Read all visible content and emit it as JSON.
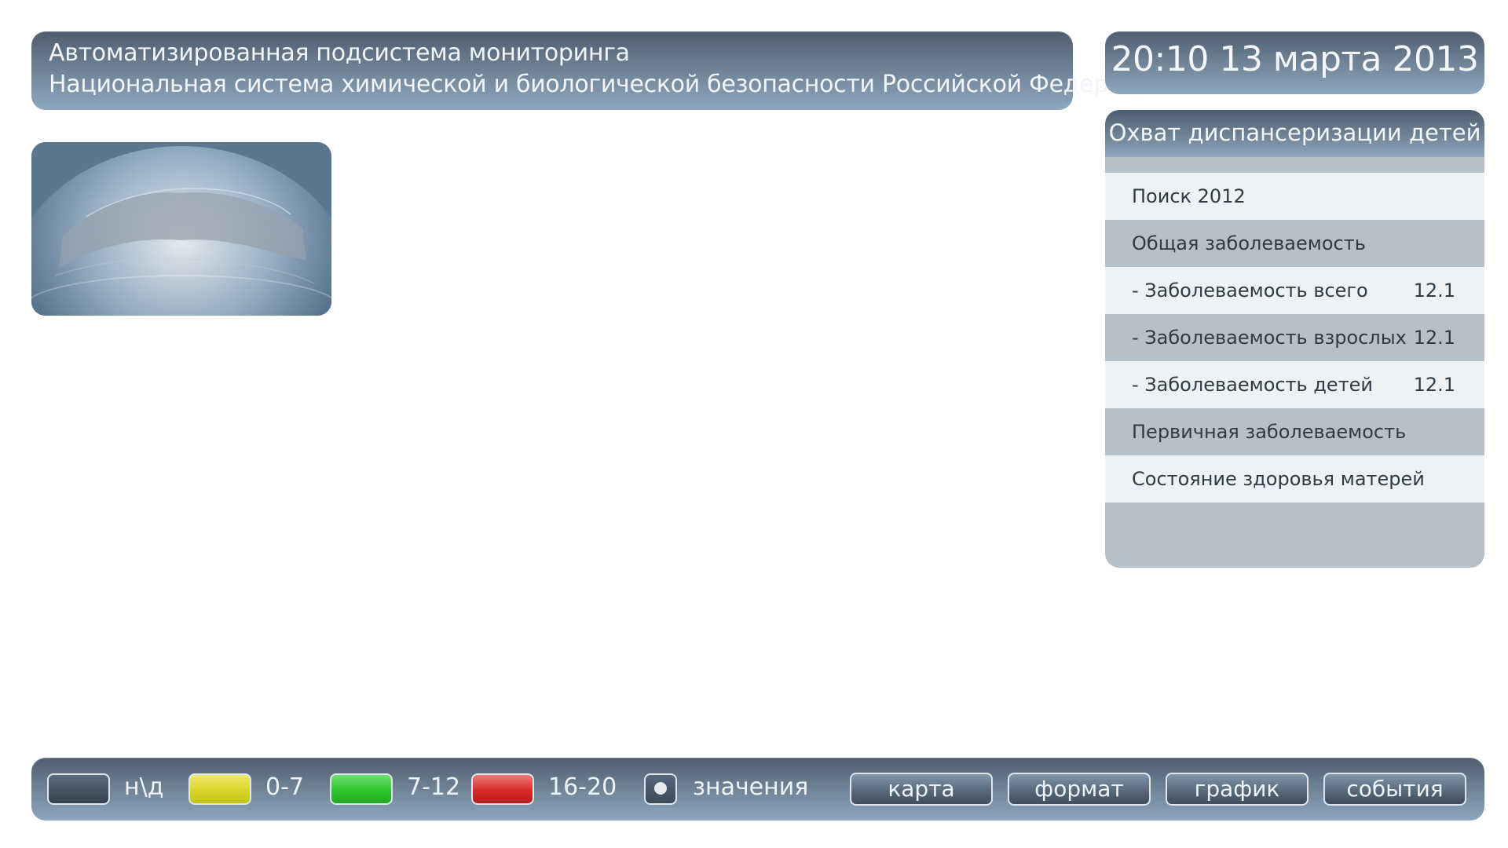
{
  "header": {
    "line1": "Автоматизированная подсистема мониторинга",
    "line2": "Национальная система химической и биологической безопасности Российской Федерации"
  },
  "clock": {
    "text": "20:10 13 марта 2013"
  },
  "panel": {
    "title": "Охват диспансеризации детей",
    "rows": [
      {
        "label": "Поиск 2012",
        "value": ""
      },
      {
        "label": "Общая заболеваемость",
        "value": ""
      },
      {
        "label": "- Заболеваемость всего",
        "value": "12.1"
      },
      {
        "label": "- Заболеваемость взрослых",
        "value": "12.1"
      },
      {
        "label": "- Заболеваемость детей",
        "value": "12.1"
      },
      {
        "label": "Первичная заболеваемость",
        "value": ""
      },
      {
        "label": "Состояние здоровья матерей",
        "value": ""
      }
    ]
  },
  "legend": {
    "items": [
      {
        "label": "н\\д",
        "color": "#3d4b59"
      },
      {
        "label": "0-7",
        "color": "#d8d528"
      },
      {
        "label": "7-12",
        "color": "#2ec52e"
      },
      {
        "label": "16-20",
        "color": "#d62a2a"
      }
    ],
    "values_label": "значения"
  },
  "nav": {
    "buttons": [
      "карта",
      "формат",
      "график",
      "события"
    ]
  },
  "globe_image": {
    "icon": "globe-earth-image"
  }
}
